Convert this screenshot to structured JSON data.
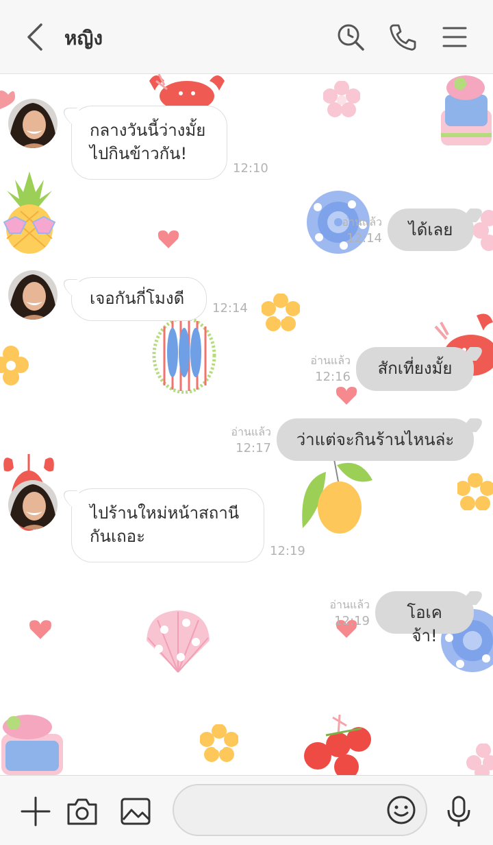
{
  "header": {
    "back_icon": "chevron-left-icon",
    "contact_name": "หญิง",
    "icons": [
      "search-history-icon",
      "phone-icon",
      "menu-icon"
    ]
  },
  "messages": [
    {
      "side": "in",
      "text_line1": "กลางวันนี้ว่างมั้ย",
      "text_line2": "ไปกินข้าวกัน!",
      "time": "12:10"
    },
    {
      "side": "out",
      "text": "ได้เลย",
      "read": "อ่านแล้ว",
      "time": "12:14"
    },
    {
      "side": "in",
      "text": "เจอกันกี่โมงดี",
      "time": "12:14"
    },
    {
      "side": "out",
      "text": "สักเที่ยงมั้ย",
      "read": "อ่านแล้ว",
      "time": "12:16"
    },
    {
      "side": "out",
      "text": "ว่าแต่จะกินร้านไหนล่ะ",
      "read": "อ่านแล้ว",
      "time": "12:17"
    },
    {
      "side": "in",
      "text_line1": "ไปร้านใหม่หน้าสถานี",
      "text_line2": "กันเถอะ",
      "time": "12:19"
    },
    {
      "side": "out",
      "text": "โอเคจ้า!",
      "read": "อ่านแล้ว",
      "time": "12:19"
    }
  ],
  "footer": {
    "icons": [
      "plus-icon",
      "camera-icon",
      "image-icon",
      "emoji-icon",
      "microphone-icon"
    ],
    "input_placeholder": ""
  },
  "colors": {
    "header_bg": "#f7f7f8",
    "incoming_bubble": "#ffffff",
    "outgoing_bubble": "#d9d9d9",
    "meta_text": "#b3b3b3"
  }
}
